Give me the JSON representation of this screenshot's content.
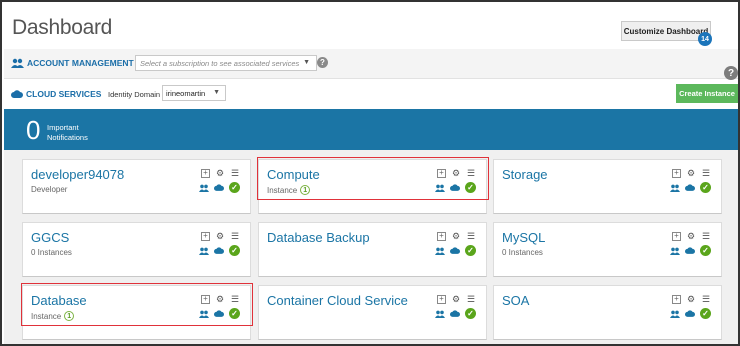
{
  "header": {
    "title": "Dashboard",
    "customize_label": "Customize Dashboard",
    "customize_count": "14"
  },
  "account_bar": {
    "label": "ACCOUNT MANAGEMENT",
    "subscription_placeholder": "Select a subscription to see associated services"
  },
  "cloud_bar": {
    "label": "CLOUD SERVICES",
    "identity_domain_label": "Identity Domain",
    "identity_domain_value": "irineomartin",
    "create_instance_label": "Create Instance"
  },
  "notifications": {
    "count": "0",
    "text": "Important Notifications"
  },
  "tiles": [
    {
      "name": "developer94078",
      "subtitle": "Developer",
      "instance_count": "",
      "highlighted": false
    },
    {
      "name": "Compute",
      "subtitle": "Instance",
      "instance_count": "1",
      "highlighted": true
    },
    {
      "name": "Storage",
      "subtitle": "",
      "instance_count": "",
      "highlighted": false
    },
    {
      "name": "GGCS",
      "subtitle": "0 Instances",
      "instance_count": "",
      "highlighted": false
    },
    {
      "name": "Database Backup",
      "subtitle": "",
      "instance_count": "",
      "highlighted": false
    },
    {
      "name": "MySQL",
      "subtitle": "0 Instances",
      "instance_count": "",
      "highlighted": false
    },
    {
      "name": "Database",
      "subtitle": "Instance",
      "instance_count": "1",
      "highlighted": true
    },
    {
      "name": "Container Cloud Service",
      "subtitle": "",
      "instance_count": "",
      "highlighted": false
    },
    {
      "name": "SOA",
      "subtitle": "",
      "instance_count": "",
      "highlighted": false
    }
  ],
  "icons": {
    "add": "plus-box-icon",
    "settings": "gear-icon",
    "menu": "list-icon",
    "users": "users-icon",
    "cloud": "cloud-icon",
    "status": "check-circle-icon",
    "help": "help-icon"
  },
  "colors": {
    "accent": "#1b75a5",
    "notification_bar": "#1b75a5",
    "create_button": "#5cb85c",
    "status_ok": "#5aa51b",
    "highlight": "#e0323a"
  }
}
